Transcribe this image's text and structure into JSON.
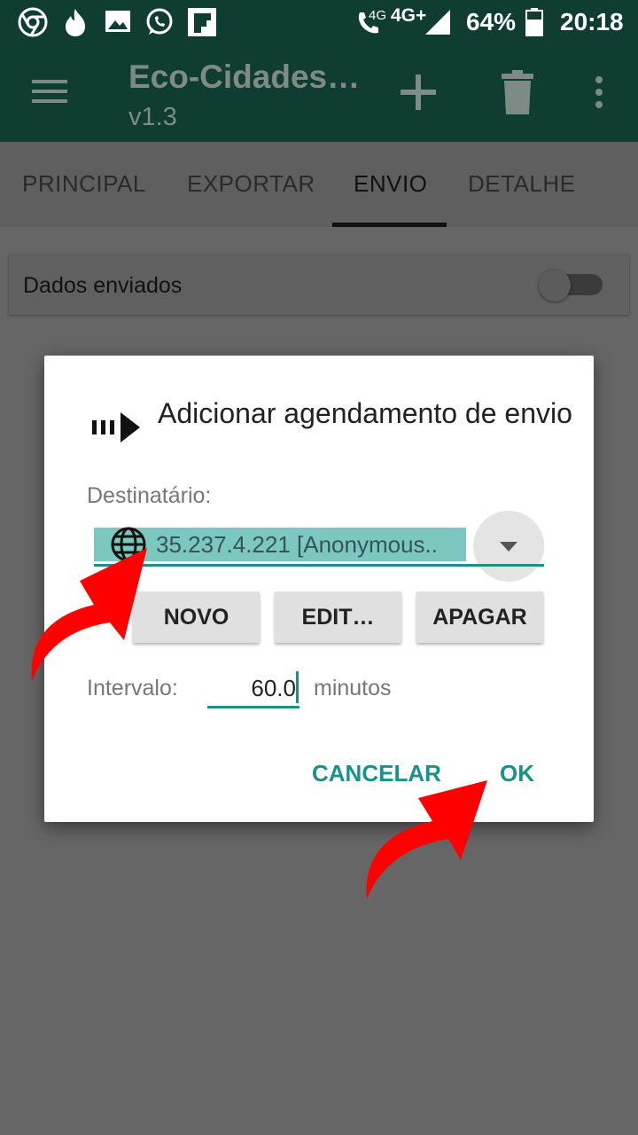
{
  "status_bar": {
    "icons": [
      "chrome-icon",
      "tinder-icon",
      "image-icon",
      "whatsapp-icon",
      "flipboard-icon"
    ],
    "network_small": "4G",
    "network": "4G+",
    "battery": "64%",
    "time": "20:18"
  },
  "app_bar": {
    "title": "Eco-Cidades…",
    "subtitle": "v1.3"
  },
  "tabs": [
    {
      "label": "PRINCIPAL"
    },
    {
      "label": "EXPORTAR"
    },
    {
      "label": "ENVIO"
    },
    {
      "label": "DETALHE"
    }
  ],
  "card": {
    "label": "Dados enviados",
    "toggle_on": false
  },
  "dialog": {
    "title": "Adicionar agendamento de envio",
    "dest_label": "Destinatário:",
    "dest_value": "35.237.4.221 [Anonymous..",
    "buttons": {
      "novo": "NOVO",
      "edit": "EDIT…",
      "apagar": "APAGAR"
    },
    "interval_label": "Intervalo:",
    "interval_value": "60.0",
    "interval_unit": "minutos",
    "cancel": "CANCELAR",
    "ok": "OK"
  },
  "colors": {
    "primary_dark": "#0f3d32",
    "accent": "#199289",
    "annotation_arrow": "#ff0000"
  }
}
